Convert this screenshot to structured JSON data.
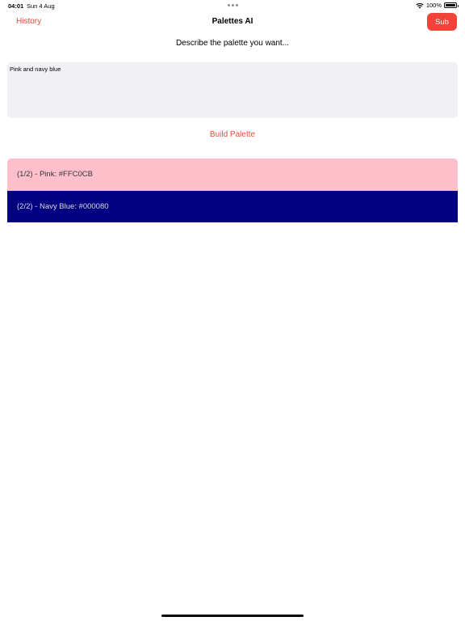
{
  "status_bar": {
    "time": "04:01",
    "date": "Sun 4 Aug",
    "battery": "100%"
  },
  "nav": {
    "history_label": "History",
    "title": "Palettes AI",
    "sub_label": "Sub"
  },
  "prompt": {
    "label": "Describe the palette you want...",
    "value": "Pink and navy blue"
  },
  "build_label": "Build Palette",
  "palette": [
    {
      "text": "(1/2) -  Pink: #FFC0CB",
      "color": "#FFC0CB",
      "tone": "light"
    },
    {
      "text": "(2/2) -  Navy Blue: #000080",
      "color": "#000080",
      "tone": "dark"
    }
  ],
  "colors": {
    "accent": "#e24b3c",
    "sub_button": "#f0443a",
    "input_bg": "#f1f1f5"
  }
}
